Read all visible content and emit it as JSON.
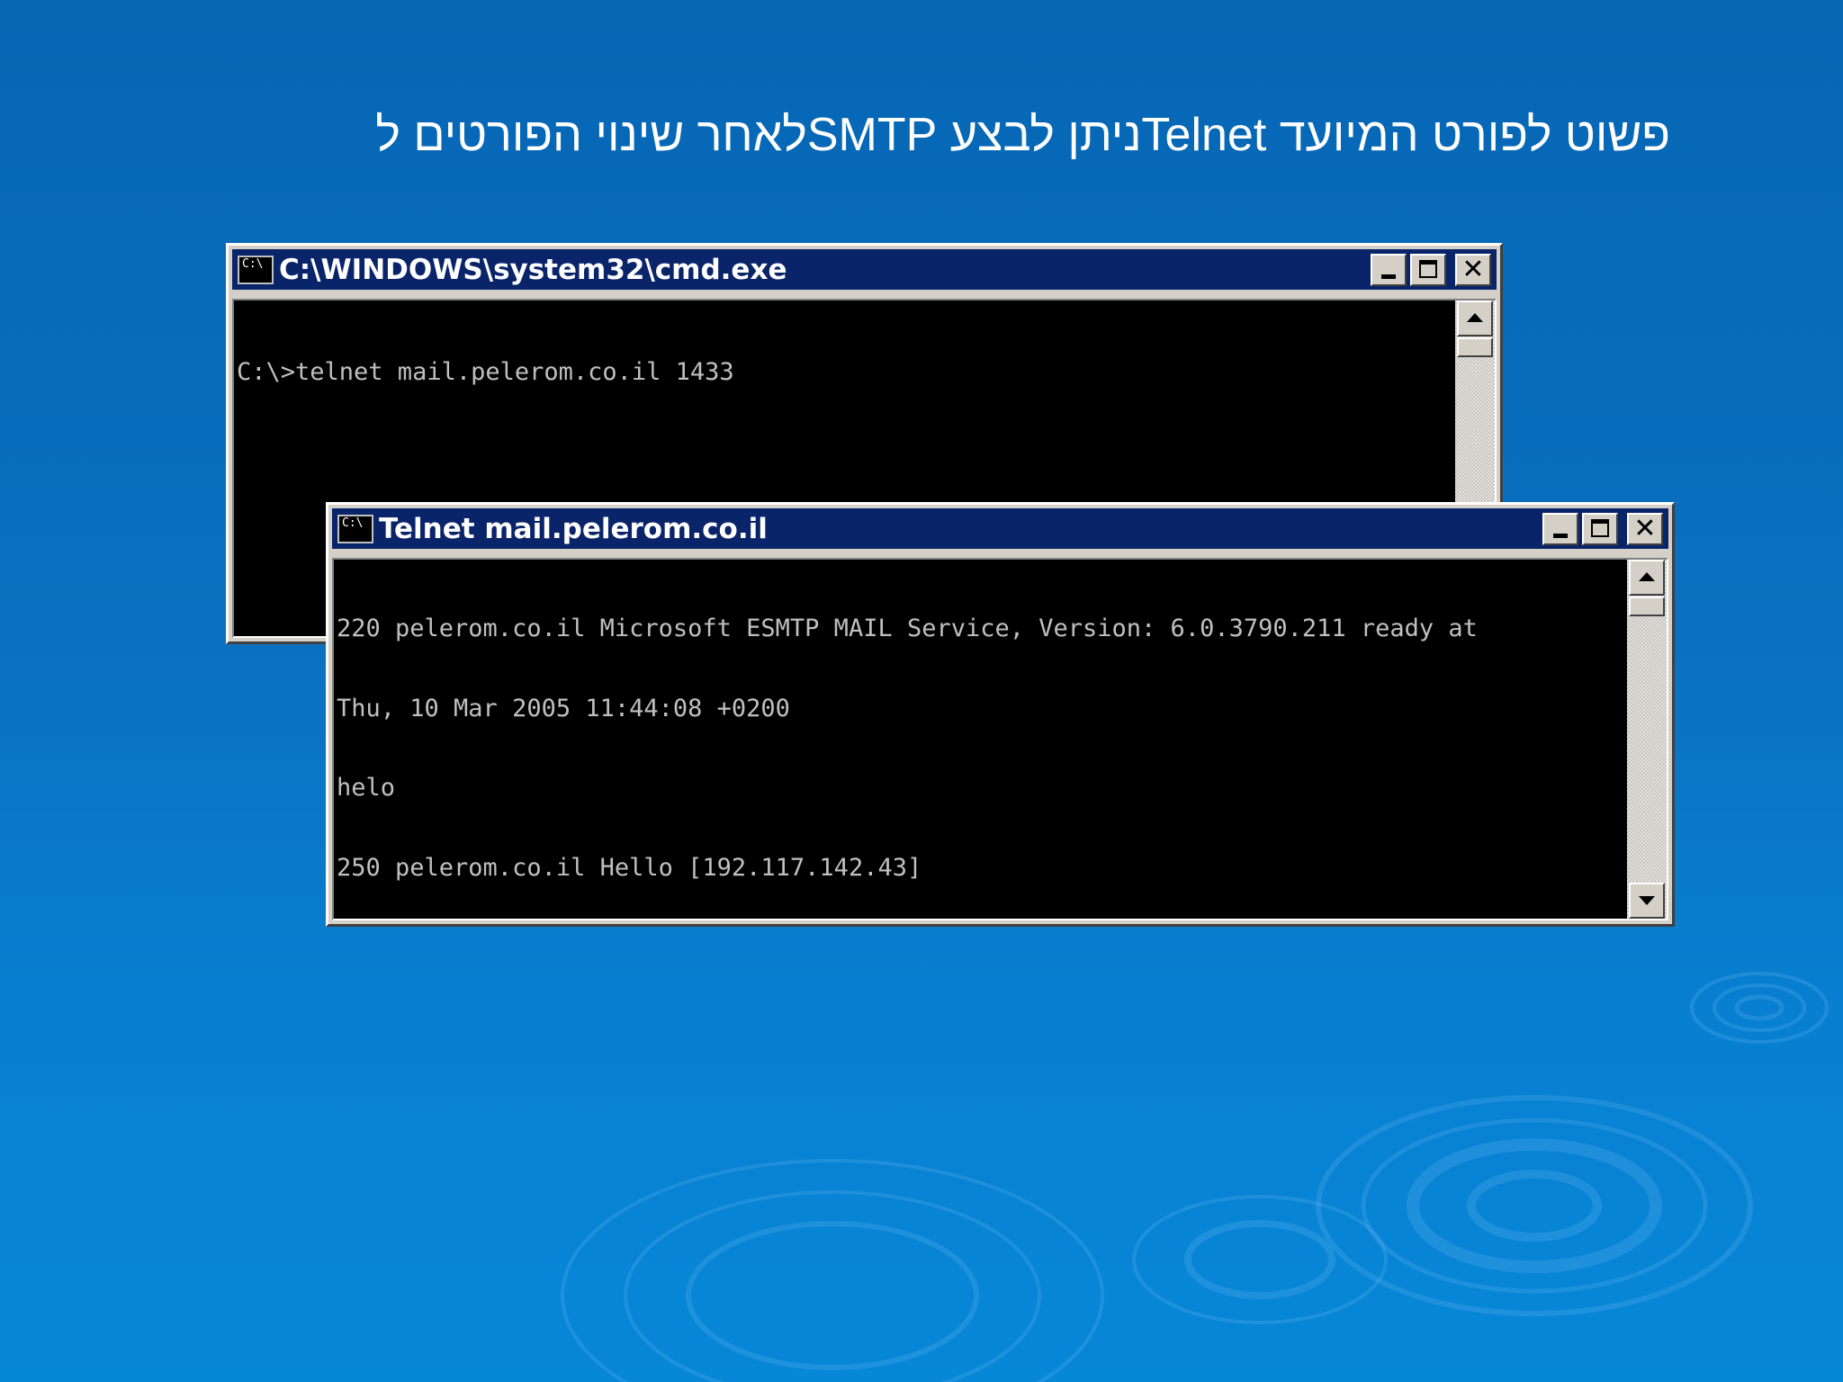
{
  "slide": {
    "heading": "פשוט לפורט המיועד  Telnetניתן לבצע  SMTPלאחר שינוי הפורטים ל"
  },
  "colors": {
    "background": "#0a70bf",
    "titlebar": "#0a246a",
    "window_frame": "#d4d0c8",
    "console_background": "#000000",
    "console_text": "#c0c0c0"
  },
  "icons": {
    "console_system_icon": "console-icon",
    "minimize": "minimize-icon",
    "maximize": "maximize-icon",
    "close": "close-icon",
    "scroll_up": "arrow-up-icon",
    "scroll_down": "arrow-down-icon"
  },
  "cmd_window": {
    "icon_text": "C:\\",
    "title": "C:\\WINDOWS\\system32\\cmd.exe",
    "lines": [
      "C:\\>telnet mail.pelerom.co.il 1433"
    ]
  },
  "telnet_window": {
    "icon_text": "C:\\",
    "title": "Telnet mail.pelerom.co.il",
    "lines": [
      "220 pelerom.co.il Microsoft ESMTP MAIL Service, Version: 6.0.3790.211 ready at",
      "Thu, 10 Mar 2005 11:44:08 +0200",
      "helo",
      "250 pelerom.co.il Hello [192.117.142.43]"
    ]
  },
  "window_buttons": {
    "close_label": "✕"
  }
}
